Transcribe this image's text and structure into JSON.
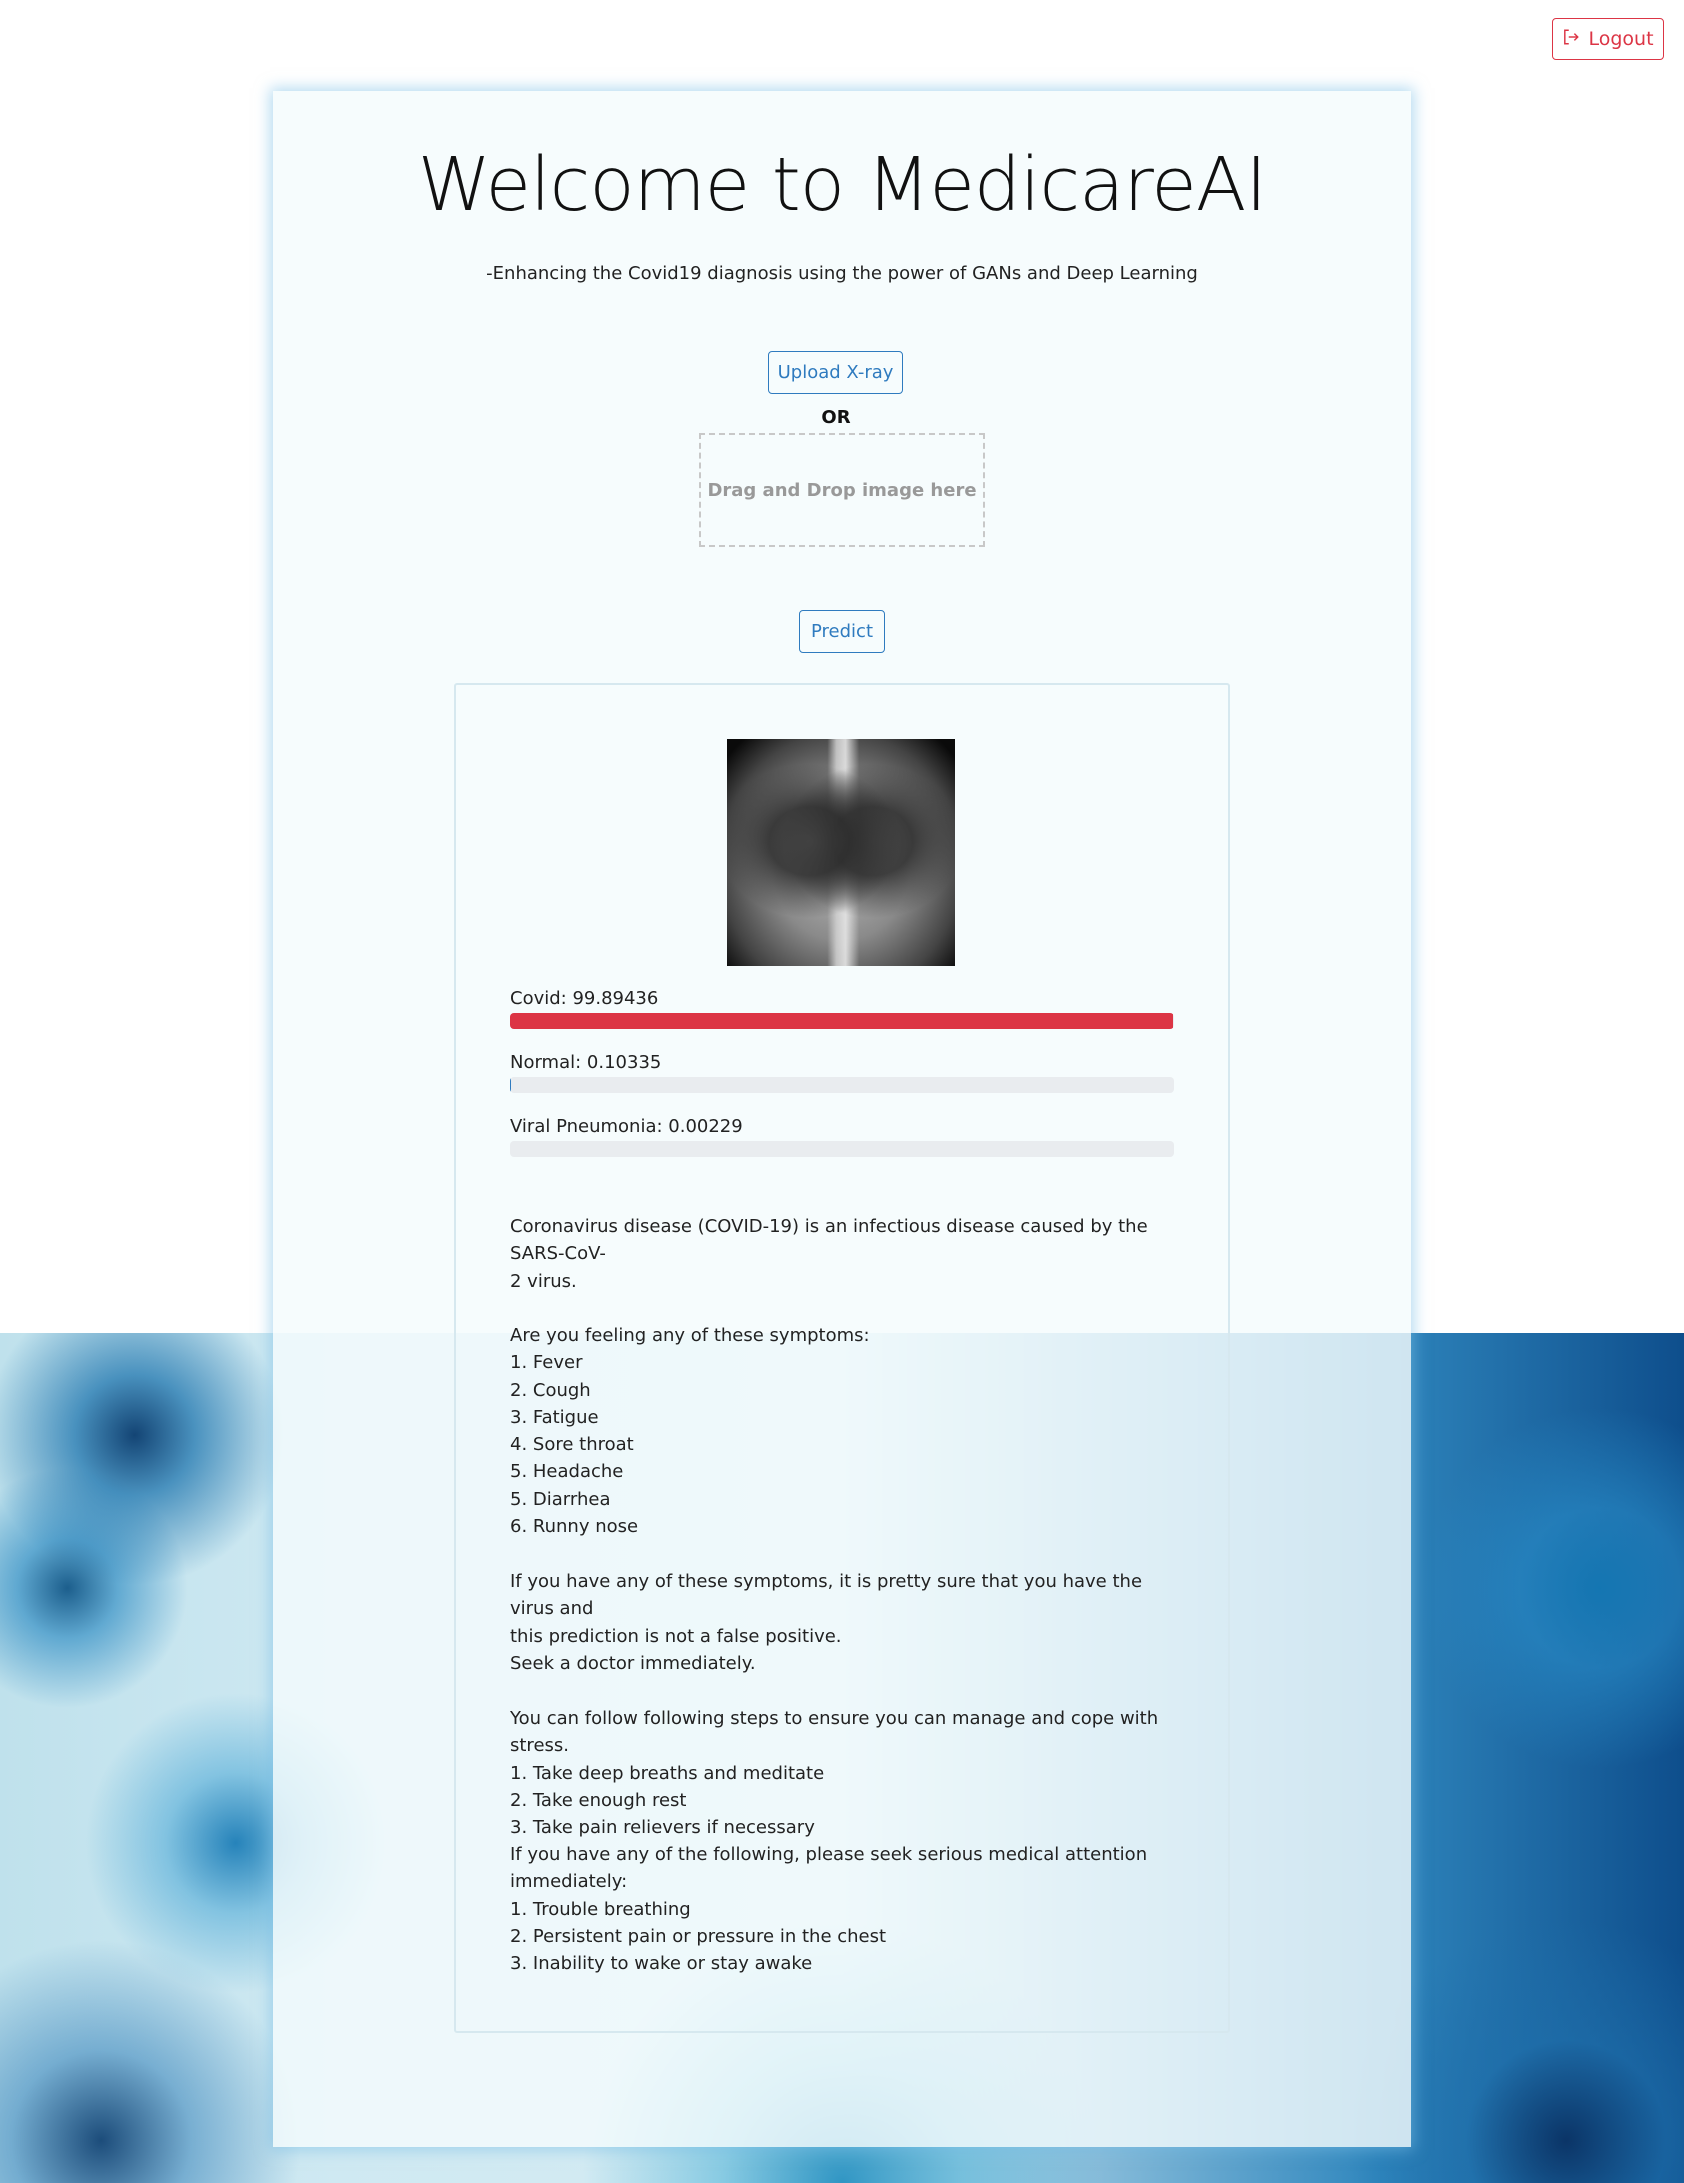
{
  "header": {
    "logout_label": "Logout"
  },
  "hero": {
    "title": "Welcome to MedicareAI",
    "subtitle": "-Enhancing the Covid19 diagnosis using the power of GANs and Deep Learning"
  },
  "upload": {
    "upload_label": "Upload X-ray",
    "or_label": "OR",
    "dropzone_label": "Drag and Drop image here",
    "predict_label": "Predict"
  },
  "results": {
    "probabilities": [
      {
        "label": "Covid: 99.89436",
        "value_percent": 99.89436,
        "color": "#dc3545"
      },
      {
        "label": "Normal: 0.10335",
        "value_percent": 0.10335,
        "color": "#2f7bbf"
      },
      {
        "label": "Viral Pneumonia: 0.00229",
        "value_percent": 0.00229,
        "color": "#2f7bbf"
      }
    ],
    "description": [
      "Coronavirus disease (COVID-19) is an infectious disease caused by the SARS-CoV-",
      "2 virus."
    ],
    "symptoms": [
      "Are you feeling any of these symptoms:",
      "1. Fever",
      "2. Cough",
      "3. Fatigue",
      "4. Sore throat",
      "5. Headache",
      "5. Diarrhea",
      "6. Runny nose"
    ],
    "warning": [
      "If you have any of these symptoms, it is pretty sure that you have the virus and",
      "this prediction is not a false positive.",
      "Seek a doctor immediately."
    ],
    "stress": [
      "You can follow following steps to ensure you can manage and cope with stress.",
      "1. Take deep breaths and meditate",
      "2. Take enough rest",
      "3. Take pain relievers if necessary"
    ],
    "emergency": [
      "If you have any of the following, please seek serious medical attention",
      "immediately:",
      "1. Trouble breathing",
      "2. Persistent pain or pressure in the chest",
      "3. Inability to wake or stay awake"
    ]
  }
}
